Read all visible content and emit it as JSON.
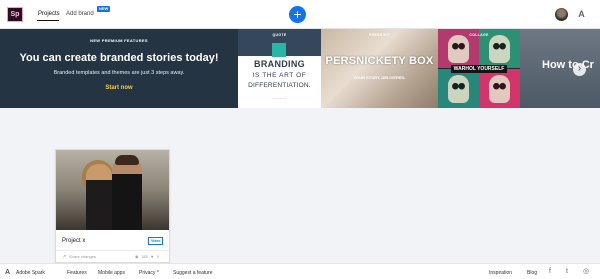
{
  "app": {
    "logo_text": "Sp"
  },
  "nav": {
    "tabs": [
      {
        "label": "Projects"
      },
      {
        "label": "Add brand"
      }
    ],
    "new_badge": "NEW",
    "create_button": "+",
    "adobe_glyph": "A"
  },
  "banner": {
    "hero": {
      "tag": "NEW PREMIUM FEATURES",
      "title": "You can create branded stories today!",
      "subtitle": "Branded templates and themes are just 3 steps away.",
      "cta": "Start now"
    },
    "cards": [
      {
        "label": "QUOTE",
        "line1": "BRANDING",
        "line2": "IS THE ART OF",
        "line3": "DIFFERENTIATION.",
        "footer": "— — — —"
      },
      {
        "label": "PRESS KIT",
        "title": "PERSNICKETY BOX",
        "subtitle": "YOUR STORY, DELIVERED."
      },
      {
        "label": "COLLAGE",
        "band": "WARHOL YOURSELF"
      },
      {
        "title": "How to Cr"
      }
    ],
    "next_glyph": "›"
  },
  "project": {
    "name": "Project x",
    "badge": "Video",
    "share_label": "Share changes",
    "views": "185",
    "likes": "0"
  },
  "footer": {
    "logo_glyph": "A",
    "links": [
      "Adobe Spark",
      "Features",
      "Mobile apps",
      "Privacy ^",
      "Suggest a feature"
    ],
    "right_links": [
      "Inspiration",
      "Blog"
    ],
    "social": [
      "f",
      "t",
      "◎"
    ]
  },
  "colors": {
    "accent": "#1473e6",
    "banner_bg": "#243443",
    "cta_yellow": "#ffcd3c",
    "content_bg": "#f2f3f6"
  }
}
